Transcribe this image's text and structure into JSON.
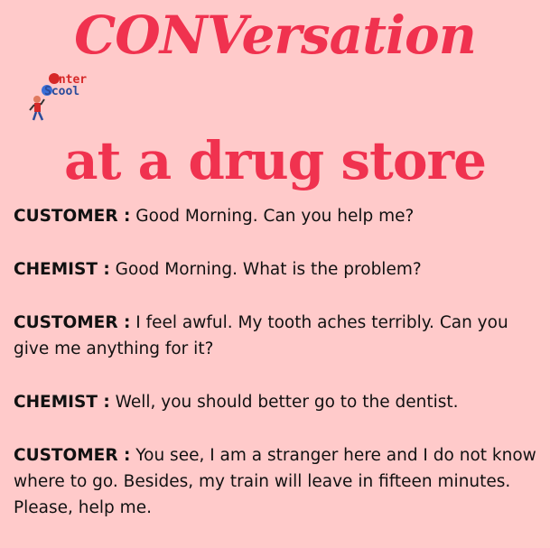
{
  "title": {
    "main": "CONVersation",
    "sub": "at a drug store"
  },
  "logo": {
    "text_top": "Inter",
    "text_bottom": "Scool"
  },
  "colors": {
    "background": "#ffcaca",
    "title": "#f0324f",
    "text": "#111111"
  },
  "dialogue": [
    {
      "speaker": "CUSTOMER :",
      "text": " Good Morning. Can you help me?"
    },
    {
      "speaker": "CHEMIST :",
      "text": " Good Morning. What is the problem?"
    },
    {
      "speaker": "CUSTOMER :",
      "text": " I feel awful. My tooth aches terribly. Can you give me anything for it?"
    },
    {
      "speaker": "CHEMIST :",
      "text": " Well, you should better go to the dentist."
    },
    {
      "speaker": "CUSTOMER :",
      "text": " You see, I am a stranger here and I do not know where to go. Besides, my train will leave in fifteen minutes. Please, help me."
    }
  ]
}
